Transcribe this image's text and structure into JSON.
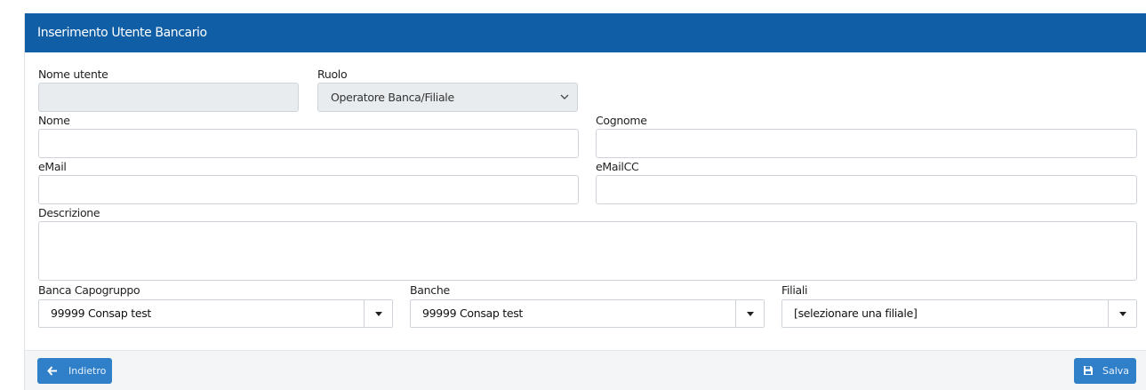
{
  "header": {
    "title": "Inserimento Utente Bancario"
  },
  "form": {
    "nome_utente": {
      "label": "Nome utente",
      "value": ""
    },
    "ruolo": {
      "label": "Ruolo",
      "value": "Operatore Banca/Filiale"
    },
    "nome": {
      "label": "Nome",
      "value": ""
    },
    "cognome": {
      "label": "Cognome",
      "value": ""
    },
    "email": {
      "label": "eMail",
      "value": ""
    },
    "emailcc": {
      "label": "eMailCC",
      "value": ""
    },
    "descrizione": {
      "label": "Descrizione",
      "value": ""
    },
    "banca_capogruppo": {
      "label": "Banca Capogruppo",
      "value": "99999 Consap test"
    },
    "banche": {
      "label": "Banche",
      "value": "99999 Consap test"
    },
    "filiali": {
      "label": "Filiali",
      "value": "[selezionare una filiale]"
    }
  },
  "footer": {
    "back_label": "Indietro",
    "back_icon": "arrow-left-icon",
    "save_label": "Salva",
    "save_icon": "floppy-disk-icon"
  },
  "colors": {
    "header_bg": "#0f5ea6",
    "button_bg": "#2f7fc9",
    "disabled_bg": "#e9ecef",
    "footer_bg": "#f4f5f7"
  }
}
